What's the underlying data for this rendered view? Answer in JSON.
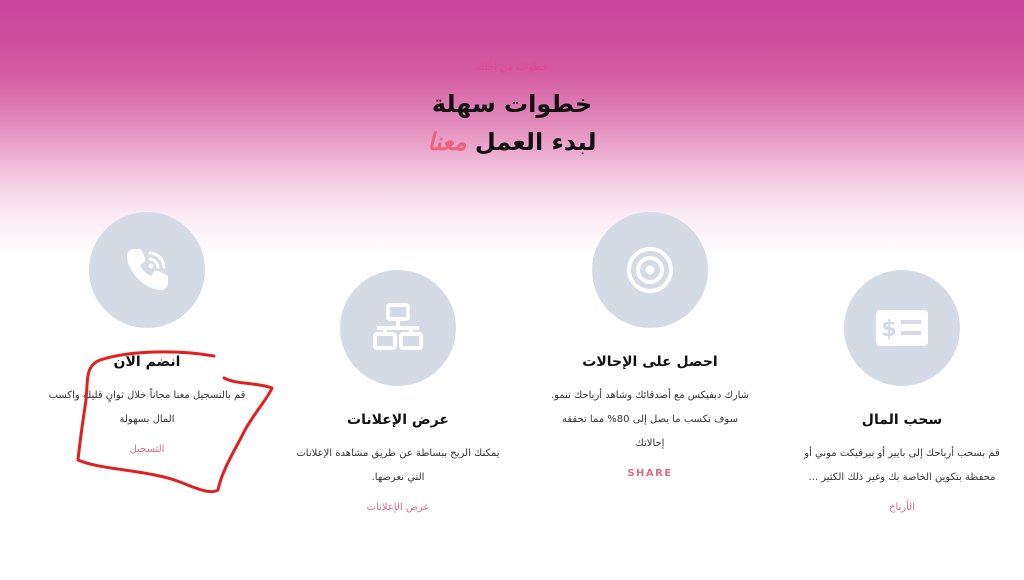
{
  "header": {
    "eyebrow": "خطوات من أجلك",
    "title_line1": "خطوات سهلة",
    "title_line2_prefix": "لبدء العمل",
    "title_line2_accent": "معنا"
  },
  "steps": [
    {
      "id": "join",
      "icon": "phone-icon",
      "title": "انضم الآن",
      "desc": "قم بالتسجيل معنا مجاناً خلال ثوانٍ قليلة واكسب المال بسهولة",
      "link": "التسجيل"
    },
    {
      "id": "ads",
      "icon": "network-icon",
      "title": "عرض الإعلانات",
      "desc": "يمكنك الربح ببساطة عن طريق مشاهدة الإعلانات التي نعرضها.",
      "link": "عرض الإعلانات"
    },
    {
      "id": "referrals",
      "icon": "target-icon",
      "title": "احصل على الإحالات",
      "desc": "شارك دبفيكس مع أصدقائك وشاهد أرباحك تنمو. سوف تكسب ما يصل إلى 80% مما تحققه إحالاتك",
      "link": "SHARE"
    },
    {
      "id": "withdraw",
      "icon": "money-bill-icon",
      "title": "سحب المال",
      "desc": "قم بسحب أرباحك إلى بايير أو بيرفيكت موني أو محفظة بتكوين الخاصة بك وغير ذلك الكثير ...",
      "link": "الأرباح"
    }
  ],
  "colors": {
    "accent": "#f0607f",
    "circle": "#d5dbe5",
    "annotation": "#e02020"
  }
}
